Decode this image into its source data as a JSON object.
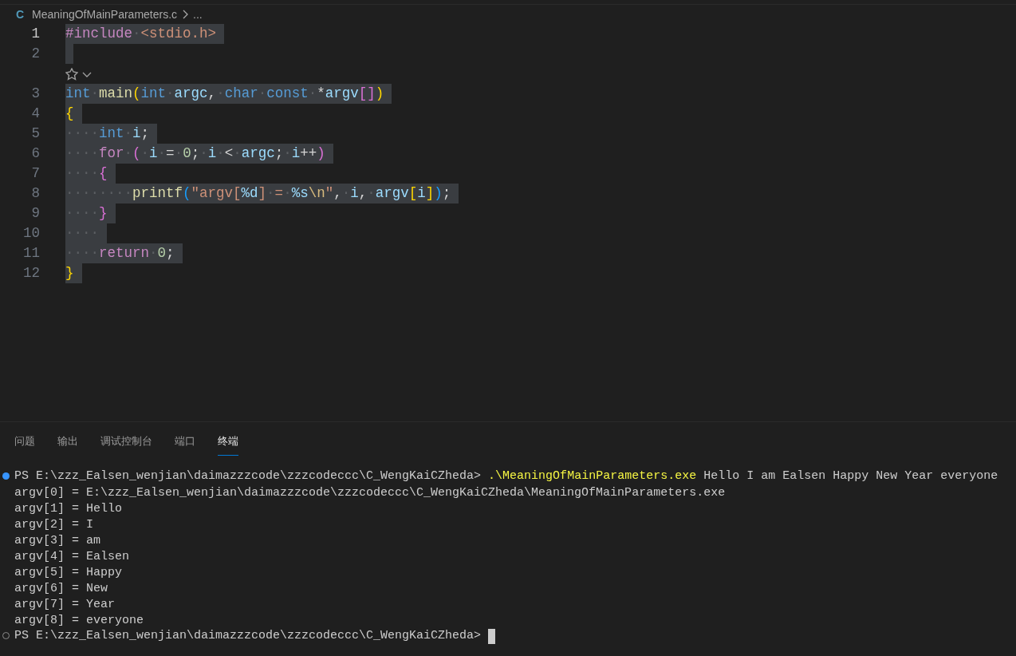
{
  "breadcrumb": {
    "file_badge": "C",
    "file": "MeaningOfMainParameters.c",
    "more": "..."
  },
  "editor": {
    "lines": [
      {
        "kind": "code",
        "number": "1",
        "current": true,
        "selected": true,
        "tokens": [
          {
            "text": "#include",
            "kind": "pp"
          },
          {
            "text": "·",
            "kind": "ws"
          },
          {
            "text": "<stdio.h>",
            "kind": "str"
          }
        ]
      },
      {
        "kind": "code",
        "number": "2",
        "current": false,
        "selected": true
      },
      {
        "kind": "codelens"
      },
      {
        "kind": "code",
        "number": "3",
        "current": false,
        "selected": true,
        "tokens": [
          {
            "text": "int",
            "kind": "type"
          },
          {
            "text": "·",
            "kind": "ws"
          },
          {
            "text": "main",
            "kind": "fn"
          },
          {
            "text": "(",
            "kind": "b1"
          },
          {
            "text": "int",
            "kind": "type"
          },
          {
            "text": "·",
            "kind": "ws"
          },
          {
            "text": "argc",
            "kind": "var"
          },
          {
            "text": ",",
            "kind": "op"
          },
          {
            "text": "·",
            "kind": "ws"
          },
          {
            "text": "char",
            "kind": "type"
          },
          {
            "text": "·",
            "kind": "ws"
          },
          {
            "text": "const",
            "kind": "type"
          },
          {
            "text": "·",
            "kind": "ws"
          },
          {
            "text": "*",
            "kind": "op"
          },
          {
            "text": "argv",
            "kind": "var"
          },
          {
            "text": "[]",
            "kind": "b2"
          },
          {
            "text": ")",
            "kind": "b1"
          }
        ]
      },
      {
        "kind": "code",
        "number": "4",
        "current": false,
        "selected": true,
        "tokens": [
          {
            "text": "{",
            "kind": "b1"
          }
        ]
      },
      {
        "kind": "code",
        "number": "5",
        "current": false,
        "selected": true,
        "tokens": [
          {
            "text": "····",
            "kind": "ws"
          },
          {
            "text": "int",
            "kind": "type"
          },
          {
            "text": "·",
            "kind": "ws"
          },
          {
            "text": "i",
            "kind": "var"
          },
          {
            "text": ";",
            "kind": "op"
          }
        ]
      },
      {
        "kind": "code",
        "number": "6",
        "current": false,
        "selected": true,
        "tokens": [
          {
            "text": "····",
            "kind": "ws"
          },
          {
            "text": "for",
            "kind": "ctl"
          },
          {
            "text": "·",
            "kind": "ws"
          },
          {
            "text": "(",
            "kind": "b2"
          },
          {
            "text": "·",
            "kind": "ws"
          },
          {
            "text": "i",
            "kind": "var"
          },
          {
            "text": "·",
            "kind": "ws"
          },
          {
            "text": "=",
            "kind": "op"
          },
          {
            "text": "·",
            "kind": "ws"
          },
          {
            "text": "0",
            "kind": "num"
          },
          {
            "text": ";",
            "kind": "op"
          },
          {
            "text": "·",
            "kind": "ws"
          },
          {
            "text": "i",
            "kind": "var"
          },
          {
            "text": "·",
            "kind": "ws"
          },
          {
            "text": "<",
            "kind": "op"
          },
          {
            "text": "·",
            "kind": "ws"
          },
          {
            "text": "argc",
            "kind": "var"
          },
          {
            "text": ";",
            "kind": "op"
          },
          {
            "text": "·",
            "kind": "ws"
          },
          {
            "text": "i",
            "kind": "var"
          },
          {
            "text": "++",
            "kind": "op"
          },
          {
            "text": ")",
            "kind": "b2"
          }
        ]
      },
      {
        "kind": "code",
        "number": "7",
        "current": false,
        "selected": true,
        "tokens": [
          {
            "text": "····",
            "kind": "ws"
          },
          {
            "text": "{",
            "kind": "b2"
          }
        ]
      },
      {
        "kind": "code",
        "number": "8",
        "current": false,
        "selected": true,
        "tokens": [
          {
            "text": "········",
            "kind": "ws"
          },
          {
            "text": "printf",
            "kind": "fn"
          },
          {
            "text": "(",
            "kind": "b3"
          },
          {
            "text": "\"argv[",
            "kind": "str"
          },
          {
            "text": "%d",
            "kind": "fmt"
          },
          {
            "text": "]",
            "kind": "str"
          },
          {
            "text": "·",
            "kind": "ws"
          },
          {
            "text": "=",
            "kind": "str"
          },
          {
            "text": "·",
            "kind": "ws"
          },
          {
            "text": "%s",
            "kind": "fmt"
          },
          {
            "text": "\\n",
            "kind": "esc"
          },
          {
            "text": "\"",
            "kind": "str"
          },
          {
            "text": ",",
            "kind": "op"
          },
          {
            "text": "·",
            "kind": "ws"
          },
          {
            "text": "i",
            "kind": "var"
          },
          {
            "text": ",",
            "kind": "op"
          },
          {
            "text": "·",
            "kind": "ws"
          },
          {
            "text": "argv",
            "kind": "var"
          },
          {
            "text": "[",
            "kind": "b1"
          },
          {
            "text": "i",
            "kind": "var"
          },
          {
            "text": "]",
            "kind": "b1"
          },
          {
            "text": ")",
            "kind": "b3"
          },
          {
            "text": ";",
            "kind": "op"
          }
        ]
      },
      {
        "kind": "code",
        "number": "9",
        "current": false,
        "selected": true,
        "tokens": [
          {
            "text": "····",
            "kind": "ws"
          },
          {
            "text": "}",
            "kind": "b2"
          }
        ]
      },
      {
        "kind": "code",
        "number": "10",
        "current": false,
        "selected": true,
        "tokens": [
          {
            "text": "····",
            "kind": "ws"
          }
        ]
      },
      {
        "kind": "code",
        "number": "11",
        "current": false,
        "selected": true,
        "tokens": [
          {
            "text": "····",
            "kind": "ws"
          },
          {
            "text": "return",
            "kind": "ctl"
          },
          {
            "text": "·",
            "kind": "ws"
          },
          {
            "text": "0",
            "kind": "num"
          },
          {
            "text": ";",
            "kind": "op"
          }
        ]
      },
      {
        "kind": "code",
        "number": "12",
        "current": false,
        "selected": true,
        "tokens": [
          {
            "text": "}",
            "kind": "b1"
          }
        ]
      }
    ]
  },
  "panel": {
    "tabs": [
      {
        "label": "问题",
        "selected": false
      },
      {
        "label": "输出",
        "selected": false
      },
      {
        "label": "调试控制台",
        "selected": false
      },
      {
        "label": "端口",
        "selected": false
      },
      {
        "label": "终端",
        "selected": true
      }
    ]
  },
  "terminal": {
    "lines": [
      {
        "kind": "command",
        "succeeded": true,
        "prompt": "PS E:\\zzz_Ealsen_wenjian\\daimazzzcode\\zzzcodeccc\\C_WengKaiCZheda>",
        "command": ".\\MeaningOfMainParameters.exe",
        "args": "Hello I am Ealsen Happy New Year everyone",
        "cursor": false
      },
      {
        "kind": "output",
        "text": "argv[0] = E:\\zzz_Ealsen_wenjian\\daimazzzcode\\zzzcodeccc\\C_WengKaiCZheda\\MeaningOfMainParameters.exe"
      },
      {
        "kind": "output",
        "text": "argv[1] = Hello"
      },
      {
        "kind": "output",
        "text": "argv[2] = I"
      },
      {
        "kind": "output",
        "text": "argv[3] = am"
      },
      {
        "kind": "output",
        "text": "argv[4] = Ealsen"
      },
      {
        "kind": "output",
        "text": "argv[5] = Happy"
      },
      {
        "kind": "output",
        "text": "argv[6] = New"
      },
      {
        "kind": "output",
        "text": "argv[7] = Year"
      },
      {
        "kind": "output",
        "text": "argv[8] = everyone"
      },
      {
        "kind": "command",
        "succeeded": false,
        "prompt": "PS E:\\zzz_Ealsen_wenjian\\daimazzzcode\\zzzcodeccc\\C_WengKaiCZheda>",
        "cursor": true
      }
    ]
  }
}
